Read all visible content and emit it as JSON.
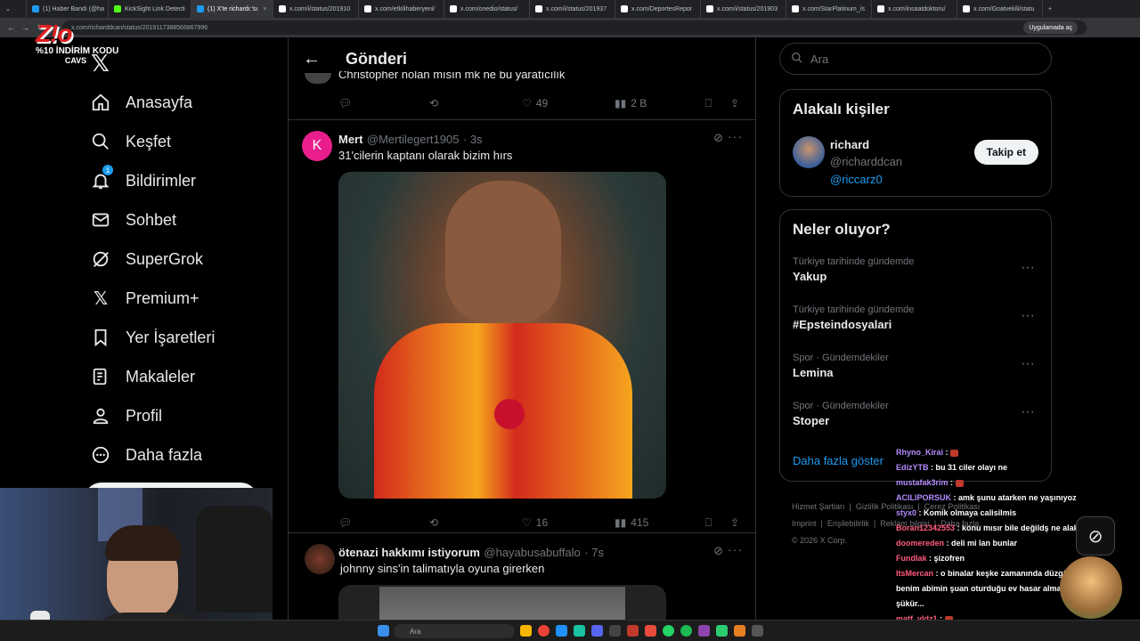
{
  "browser": {
    "tabs": [
      {
        "label": "(1) Haber Bandı (@ha"
      },
      {
        "label": "KickSight Link Detecti"
      },
      {
        "label": "(1) X'te richardı:'sı",
        "active": true
      },
      {
        "label": "x.com/i/status/201910"
      },
      {
        "label": "x.com/etkilihaberyeni/"
      },
      {
        "label": "x.com/onedio/status/"
      },
      {
        "label": "x.com/i/status/201937"
      },
      {
        "label": "x.com/DeportesRepor"
      },
      {
        "label": "x.com/i/status/201903"
      },
      {
        "label": "x.com/StarPlatinum_/s"
      },
      {
        "label": "x.com/insaatdoktoru/"
      },
      {
        "label": "x.com/Goatvekili/statu"
      }
    ],
    "url": "x.com/richarddcan/status/2019117388566867996",
    "app_button": "Uygulamada aç"
  },
  "overlay": {
    "logo_text": "Z!o",
    "promo_line1": "%10 İNDİRİM KODU",
    "promo_line2": "CAVS"
  },
  "nav": {
    "items": [
      {
        "label": "Anasayfa",
        "icon": "home-icon"
      },
      {
        "label": "Keşfet",
        "icon": "search-icon"
      },
      {
        "label": "Bildirimler",
        "icon": "bell-icon",
        "badge": "1"
      },
      {
        "label": "Sohbet",
        "icon": "mail-icon"
      },
      {
        "label": "SuperGrok",
        "icon": "grok-icon"
      },
      {
        "label": "Premium+",
        "icon": "x-logo-icon"
      },
      {
        "label": "Yer İşaretleri",
        "icon": "bookmark-icon"
      },
      {
        "label": "Makaleler",
        "icon": "article-icon"
      },
      {
        "label": "Profil",
        "icon": "person-icon"
      },
      {
        "label": "Daha fazla",
        "icon": "more-circle-icon"
      }
    ]
  },
  "center": {
    "header_title": "Gönderi",
    "top_tweet": {
      "partial_text": "Christopher nolan mısın mk ne bu yaratıcılık",
      "likes": "49",
      "views": "2 B"
    },
    "tweet1": {
      "avatar_letter": "K",
      "name": "Mert",
      "handle": "@Mertilegert1905",
      "time": "· 3s",
      "text": "31'cilerin kaptanı olarak bizim hırs",
      "likes": "16",
      "views": "415"
    },
    "tweet2": {
      "name": "ötenazi hakkımı istiyorum",
      "handle": "@hayabusabuffalo",
      "time": "· 7s",
      "text": "johnny sins'in talimatıyla oyuna girerken"
    }
  },
  "right": {
    "search_placeholder": "Ara",
    "related": {
      "title": "Alakalı kişiler",
      "name": "richard",
      "handle": "@richarddcan",
      "bio": "@riccarz0",
      "follow": "Takip et"
    },
    "trends": {
      "title": "Neler oluyor?",
      "items": [
        {
          "category": "Türkiye tarihinde gündemde",
          "name": "Yakup"
        },
        {
          "category": "Türkiye tarihinde gündemde",
          "name": "#Epsteindosyalari"
        },
        {
          "category": "Spor · Gündemdekiler",
          "name": "Lemina"
        },
        {
          "category": "Spor · Gündemdekiler",
          "name": "Stoper"
        }
      ],
      "show_more": "Daha fazla göster"
    },
    "footer": {
      "l1": "Hizmet Şartları",
      "l2": "Gizlilik Politikası",
      "l3": "Çerez Politikası",
      "l4": "Imprint",
      "l5": "Erişilebilirlik",
      "l6": "Reklam bilgisi",
      "l7": "Daha fazla ...",
      "copyright": "© 2026 X Corp."
    }
  },
  "chat": {
    "messages": [
      {
        "user": "Rhyno_Kirai",
        "color": "#b48cff",
        "text": ""
      },
      {
        "user": "EdizYTB",
        "color": "#b48cff",
        "text": "bu 31 ciler olayı ne"
      },
      {
        "user": "mustafak3rim",
        "color": "#b48cff",
        "text": ""
      },
      {
        "user": "ACILIPORSUK",
        "color": "#b48cff",
        "text": "amk şunu atarken ne yaşınıyoz"
      },
      {
        "user": "styx0",
        "color": "#b48cff",
        "text": "Komik olmaya calisilmis"
      },
      {
        "user": "Boran12342553",
        "color": "#ff5b7f",
        "text": "konu mısır bile değildş ne alaka"
      },
      {
        "user": "doomereden",
        "color": "#ff5b7f",
        "text": "deli mi lan bunlar"
      },
      {
        "user": "Fundlak",
        "color": "#ff5b7f",
        "text": "şizofren"
      },
      {
        "user": "ItsMercan",
        "color": "#ff5b7f",
        "text": "o binalar keşke zamanında düzgün yapılsaydı benim abimin şuan oturduğu ev hasar almamış mesela çok şükür..."
      },
      {
        "user": "matf_yldz1",
        "color": "#ff5b7f",
        "text": ""
      }
    ]
  },
  "taskbar": {
    "search_placeholder": "Ara"
  },
  "colors": {
    "accent": "#1d9bf0",
    "border": "#2f3336",
    "muted": "#71767b"
  }
}
